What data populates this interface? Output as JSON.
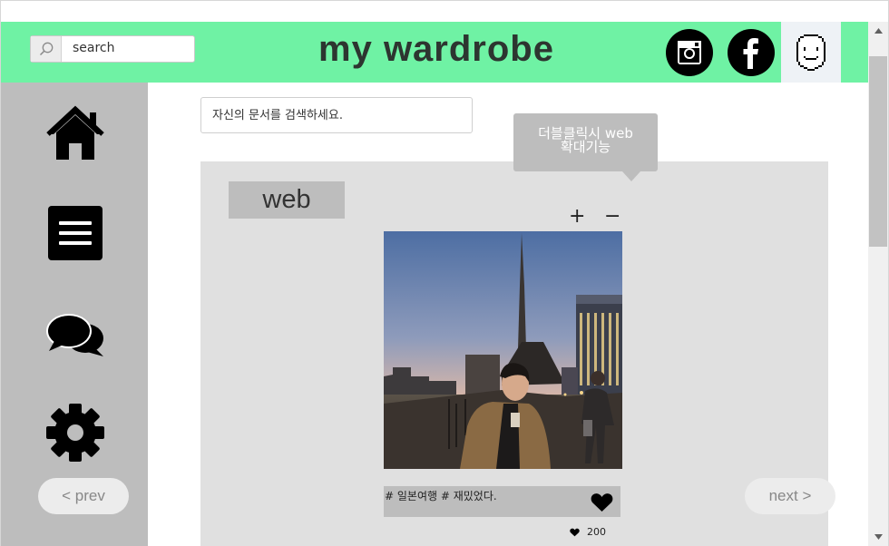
{
  "header": {
    "search_placeholder": "search",
    "title": "my wardrobe",
    "social_icons": [
      "instagram-icon",
      "facebook-icon"
    ],
    "avatar_icon": "smiley-face-icon",
    "background_color": "#6ff2a4"
  },
  "sidebar": {
    "items": [
      {
        "icon": "home-icon"
      },
      {
        "icon": "menu-icon"
      },
      {
        "icon": "chat-icon"
      },
      {
        "icon": "gear-icon"
      }
    ],
    "prev_label": "< prev"
  },
  "main": {
    "doc_search_placeholder": "자신의 문서를 검색하세요.",
    "tooltip": {
      "line1": "더블클릭시 web",
      "line2": "확대기능"
    },
    "card": {
      "category": "web",
      "zoom_in": "+",
      "zoom_out": "−",
      "caption": "# 일본여행 # 재밌었다.",
      "likes": "200"
    },
    "next_label": "next >"
  },
  "colors": {
    "accent": "#6ff2a4",
    "sidebar": "#bdbdbd",
    "panel": "#e0e0e0"
  }
}
